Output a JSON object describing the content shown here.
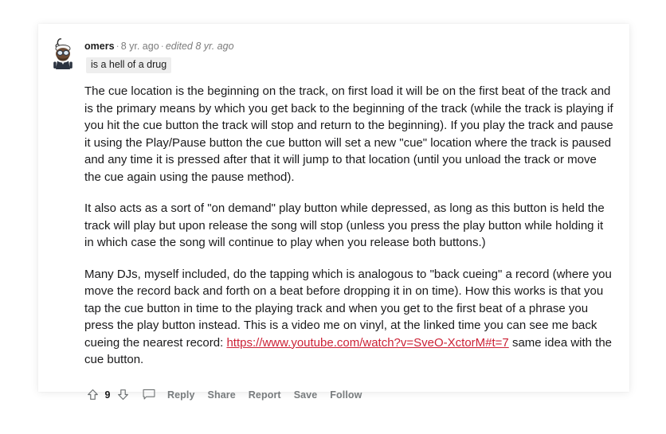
{
  "comment": {
    "avatar_icon": "reddit-snoo-avatar-icon",
    "username": "omers",
    "separator": "·",
    "age": "8 yr. ago",
    "edited": "edited 8 yr. ago",
    "flair": "is a hell of a drug",
    "paragraphs": [
      {
        "segments": [
          {
            "type": "text",
            "text": "The cue location is the beginning on the track, on first load it will be on the first beat of the track and is the primary means by which you get back to the beginning of the track (while the track is playing if you hit the cue button the track will stop and return to the beginning). If you play the track and pause it using the Play/Pause button the cue button will set a new \"cue\" location where the track is paused and any time it is pressed after that it will jump to that location (until you unload the track or move the cue again using the pause method)."
          }
        ]
      },
      {
        "segments": [
          {
            "type": "text",
            "text": "It also acts as a sort of \"on demand\" play button while depressed, as long as this button is held the track will play but upon release the song will stop (unless you press the play button while holding it in which case the song will continue to play when you release both buttons.)"
          }
        ]
      },
      {
        "segments": [
          {
            "type": "text",
            "text": "Many DJs, myself included, do the tapping which is analogous to \"back cueing\" a record (where you move the record back and forth on a beat before dropping it in on time). How this works is that you tap the cue button in time to the playing track and when you get to the first beat of a phrase you press the play button instead. This is a video me on vinyl, at the linked time you can see me back cueing the nearest record: "
          },
          {
            "type": "link",
            "text": "https://www.youtube.com/watch?v=SveO-XctorM#t=7"
          },
          {
            "type": "text",
            "text": " same idea with the cue button."
          }
        ]
      }
    ],
    "actions": {
      "upvote_icon": "upvote-arrow-icon",
      "score": "9",
      "downvote_icon": "downvote-arrow-icon",
      "comment_icon": "comment-bubble-icon",
      "reply_label": "Reply",
      "share_label": "Share",
      "report_label": "Report",
      "save_label": "Save",
      "follow_label": "Follow"
    }
  },
  "colors": {
    "link": "#cc2236",
    "body_text": "#1a1a1b",
    "meta_text": "#7c7c7c",
    "action_text": "#787c7e",
    "flair_bg": "#eeeeee"
  }
}
